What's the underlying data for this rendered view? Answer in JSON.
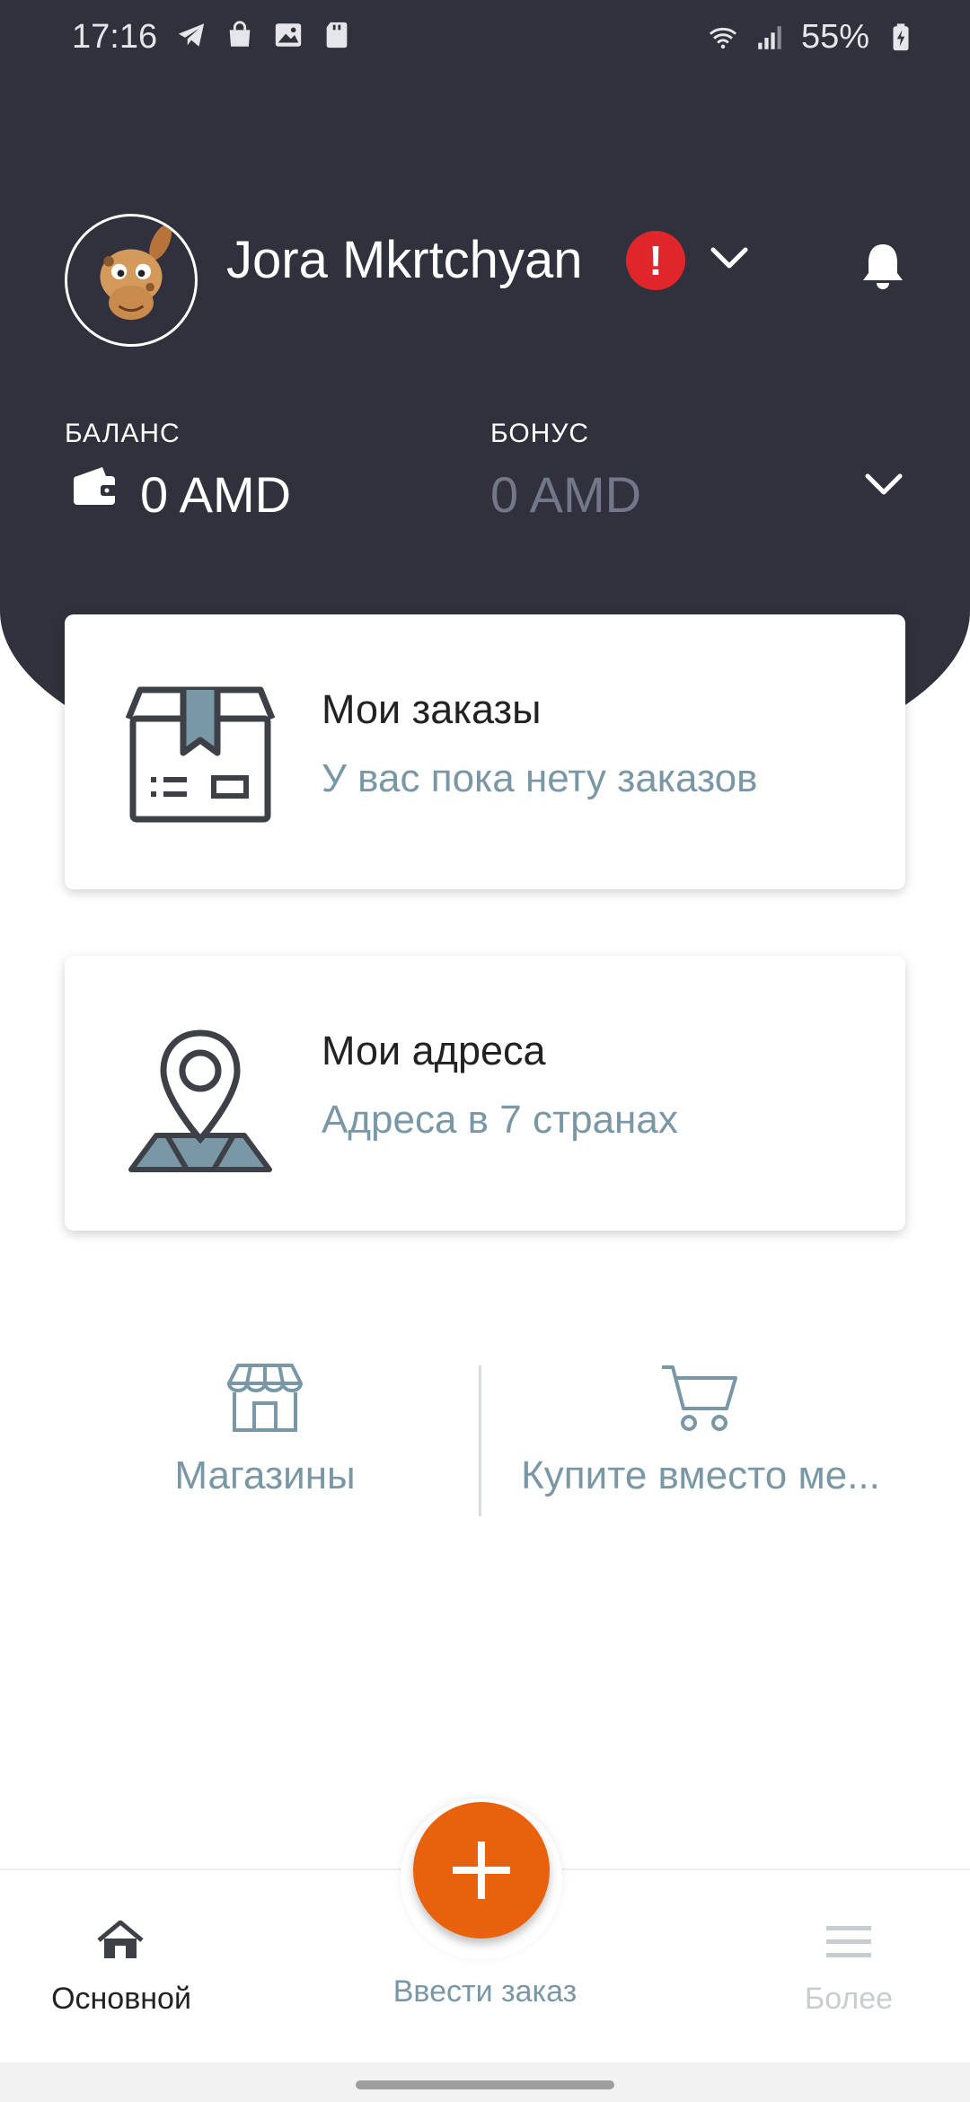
{
  "status_bar": {
    "time": "17:16",
    "battery": "55%",
    "left_icons": [
      "telegram-icon",
      "shopping-bag-icon",
      "gallery-icon",
      "sd-card-icon"
    ],
    "right_icons": [
      "wifi-icon",
      "signal-icon",
      "battery-charging-icon"
    ]
  },
  "header": {
    "user_name": "Jora Mkrtchyan",
    "alert_symbol": "!",
    "colors": {
      "background": "#30313c",
      "alert": "#e0252b"
    }
  },
  "balance": {
    "balance_label": "БАЛАНС",
    "balance_value": "0 AMD",
    "bonus_label": "БОНУС",
    "bonus_value": "0 AMD"
  },
  "cards": [
    {
      "icon": "package-box-icon",
      "title": "Мои заказы",
      "subtitle": "У вас пока нету заказов"
    },
    {
      "icon": "location-map-icon",
      "title": "Мои адреса",
      "subtitle": "Адреса в 7 странах"
    }
  ],
  "quick_links": [
    {
      "icon": "store-icon",
      "label": "Магазины"
    },
    {
      "icon": "cart-icon",
      "label": "Купите вместо ме..."
    }
  ],
  "bottom_nav": {
    "home_label": "Основной",
    "add_order_label": "Ввести заказ",
    "more_label": "Более",
    "fab_color": "#e8620e"
  }
}
